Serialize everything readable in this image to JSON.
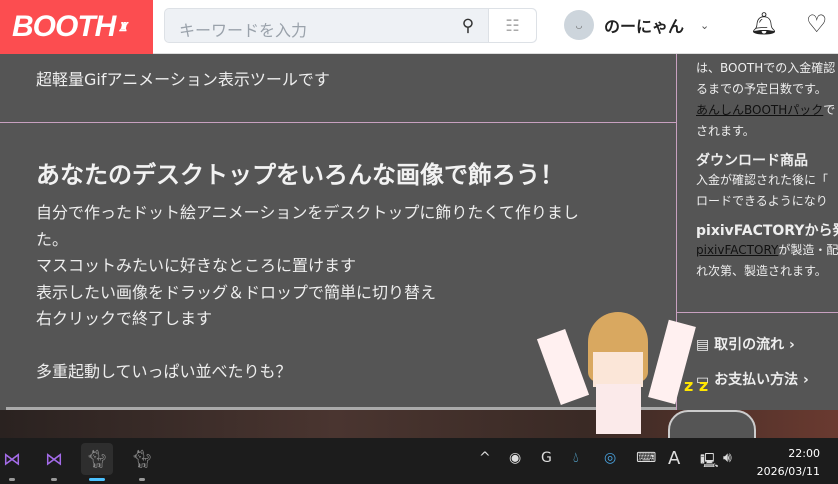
{
  "header": {
    "logo": "BOOTH",
    "search_placeholder": "キーワードを入力",
    "username": "のーにゃん"
  },
  "main": {
    "tagline": "超軽量Gifアニメーション表示ツールです",
    "heading": "あなたのデスクトップをいろんな画像で飾ろう！",
    "description": [
      "自分で作ったドット絵アニメーションをデスクトップに飾りたくて作りまし",
      "た。",
      "マスコットみたいに好きなところに置けます",
      "表示したい画像をドラッグ＆ドロップで簡単に切り替え",
      "右クリックで終了します",
      "",
      "多重起動していっぱい並べたりも？"
    ]
  },
  "sidebar": {
    "line1": "は、BOOTHでの入金確認",
    "line2": "るまでの予定日数です。",
    "anshin_link": "あんしんBOOTHパック",
    "anshin_after": "で",
    "line4": "されます。",
    "download_title": "ダウンロード商品",
    "download_1": "入金が確認された後に「",
    "download_2": "ロードできるようになり",
    "pixiv_title": "pixivFACTORYから発",
    "pixiv_link": "pixivFACTORY",
    "pixiv_after": "が製造・配",
    "pixiv_2": "れ次第、製造されます。",
    "flow_link": "取引の流れ",
    "payment_link": "お支払い方法"
  },
  "taskbar": {
    "time": "22:00",
    "date": "2026/03/11",
    "ime": "A"
  }
}
